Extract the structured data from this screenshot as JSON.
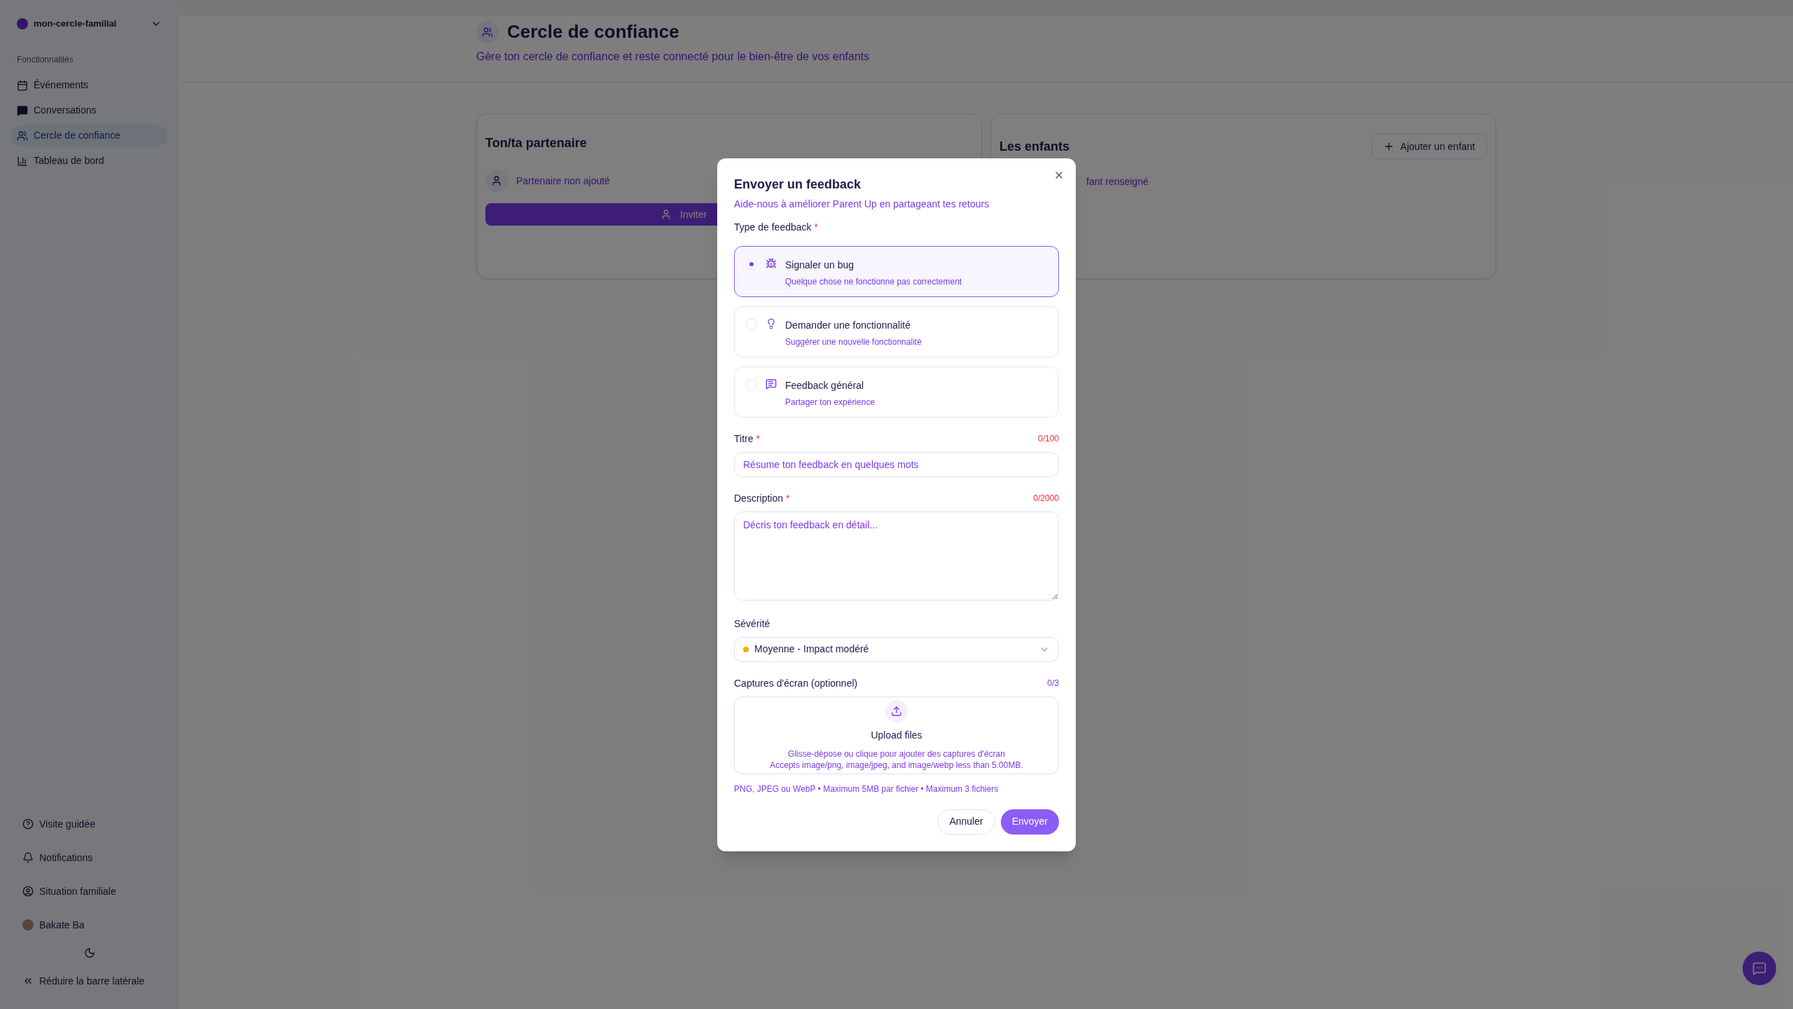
{
  "sidebar": {
    "workspace": "mon-cercle-familial",
    "section_label": "Fonctionnalités",
    "items": [
      {
        "label": "Événements",
        "selected": false
      },
      {
        "label": "Conversations",
        "selected": false
      },
      {
        "label": "Cercle de confiance",
        "selected": true
      },
      {
        "label": "Tableau de bord",
        "selected": false
      }
    ],
    "footer_items": [
      {
        "label": "Visite guidée"
      },
      {
        "label": "Notifications"
      },
      {
        "label": "Situation familiale"
      },
      {
        "label": "Bakate Ba"
      }
    ],
    "collapse_label": "Réduire la barre latérale"
  },
  "header": {
    "title": "Cercle de confiance",
    "subtitle": "Gère ton cercle de confiance et reste connecté pour le bien-être de vos enfants"
  },
  "partner_card": {
    "title": "Ton/ta partenaire",
    "status": "Partenaire non ajouté",
    "invite_button": "Inviter"
  },
  "children_card": {
    "title": "Les enfants",
    "add_button": "Ajouter un enfant",
    "status": "fant renseigné"
  },
  "dialog": {
    "title": "Envoyer un feedback",
    "subtitle": "Aide-nous à améliorer Parent Up en partageant tes retours",
    "type_label": "Type de feedback",
    "type_required_mark": "*",
    "options": [
      {
        "kind": "bug",
        "title": "Signaler un bug",
        "description": "Quelque chose ne fonctionne pas correctement",
        "selected": true
      },
      {
        "kind": "idea",
        "title": "Demander une fonctionnalité",
        "description": "Suggérer une nouvelle fonctionnalité",
        "selected": false
      },
      {
        "kind": "general",
        "title": "Feedback général",
        "description": "Partager ton expérience",
        "selected": false
      }
    ],
    "title_field": {
      "label": "Titre",
      "required_mark": "*",
      "counter": "0/100",
      "placeholder": "Résume ton feedback en quelques mots"
    },
    "description_field": {
      "label": "Description",
      "required_mark": "*",
      "counter": "0/2000",
      "placeholder": "Décris ton feedback en détail..."
    },
    "severity": {
      "label": "Sévérité",
      "value": "Moyenne - Impact modéré",
      "color": "#eab308"
    },
    "screenshots": {
      "label": "Captures d'écran (optionnel)",
      "counter": "0/3",
      "upload_title": "Upload files",
      "upload_hint": "Glisse-dépose ou clique pour ajouter des captures d'écran",
      "upload_accepts": "Accepts image/png, image/jpeg, and image/webp less than 5.00MB.",
      "note": "PNG, JPEG ou WebP • Maximum 5MB par fichier • Maximum 3 fichiers"
    },
    "cancel_button": "Annuler",
    "submit_button": "Envoyer"
  }
}
